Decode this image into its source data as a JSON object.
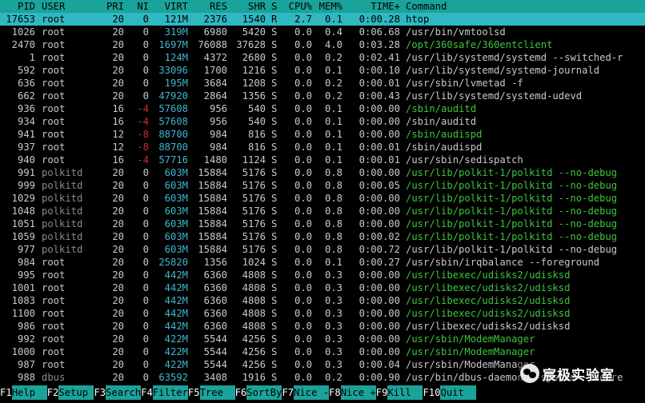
{
  "header": {
    "pid": "PID",
    "user": "USER",
    "pri": "PRI",
    "ni": "NI",
    "virt": "VIRT",
    "res": "RES",
    "shr": "SHR",
    "s": "S",
    "cpu": "CPU%",
    "mem": "MEM%",
    "time": "TIME+",
    "command": "Command"
  },
  "processes": [
    {
      "pid": "17653",
      "user": "root",
      "pri": "20",
      "ni": "0",
      "virt": "121M",
      "res": "2376",
      "shr": "1540",
      "s": "R",
      "cpu": "2.7",
      "mem": "0.1",
      "time": "0:00.28",
      "command": "htop",
      "selected": true
    },
    {
      "pid": "1026",
      "user": "root",
      "pri": "20",
      "ni": "0",
      "virt": "319M",
      "res": "6980",
      "shr": "5420",
      "s": "S",
      "cpu": "0.0",
      "mem": "0.4",
      "time": "0:06.68",
      "command": "/usr/bin/vmtoolsd"
    },
    {
      "pid": "2470",
      "user": "root",
      "pri": "20",
      "ni": "0",
      "virt": "1697M",
      "res": "76088",
      "shr": "37628",
      "s": "S",
      "cpu": "0.0",
      "mem": "4.0",
      "time": "0:03.28",
      "command": "/opt/360safe/360entclient",
      "thread": true
    },
    {
      "pid": "1",
      "user": "root",
      "pri": "20",
      "ni": "0",
      "virt": "124M",
      "res": "4372",
      "shr": "2680",
      "s": "S",
      "cpu": "0.0",
      "mem": "0.2",
      "time": "0:02.41",
      "command": "/usr/lib/systemd/systemd --switched-r"
    },
    {
      "pid": "592",
      "user": "root",
      "pri": "20",
      "ni": "0",
      "virt": "33096",
      "res": "1700",
      "shr": "1216",
      "s": "S",
      "cpu": "0.0",
      "mem": "0.1",
      "time": "0:00.10",
      "command": "/usr/lib/systemd/systemd-journald"
    },
    {
      "pid": "636",
      "user": "root",
      "pri": "20",
      "ni": "0",
      "virt": "195M",
      "res": "3684",
      "shr": "1208",
      "s": "S",
      "cpu": "0.0",
      "mem": "0.2",
      "time": "0:00.01",
      "command": "/usr/sbin/lvmetad -f"
    },
    {
      "pid": "662",
      "user": "root",
      "pri": "20",
      "ni": "0",
      "virt": "47920",
      "res": "2864",
      "shr": "1356",
      "s": "S",
      "cpu": "0.0",
      "mem": "0.2",
      "time": "0:00.43",
      "command": "/usr/lib/systemd/systemd-udevd"
    },
    {
      "pid": "936",
      "user": "root",
      "pri": "16",
      "ni": "-4",
      "virt": "57608",
      "res": "956",
      "shr": "540",
      "s": "S",
      "cpu": "0.0",
      "mem": "0.1",
      "time": "0:00.00",
      "command": "/sbin/auditd",
      "thread": true
    },
    {
      "pid": "934",
      "user": "root",
      "pri": "16",
      "ni": "-4",
      "virt": "57608",
      "res": "956",
      "shr": "540",
      "s": "S",
      "cpu": "0.0",
      "mem": "0.1",
      "time": "0:00.00",
      "command": "/sbin/auditd"
    },
    {
      "pid": "941",
      "user": "root",
      "pri": "12",
      "ni": "-8",
      "virt": "88700",
      "res": "984",
      "shr": "816",
      "s": "S",
      "cpu": "0.0",
      "mem": "0.1",
      "time": "0:00.00",
      "command": "/sbin/audispd",
      "thread": true
    },
    {
      "pid": "937",
      "user": "root",
      "pri": "12",
      "ni": "-8",
      "virt": "88700",
      "res": "984",
      "shr": "816",
      "s": "S",
      "cpu": "0.0",
      "mem": "0.1",
      "time": "0:00.01",
      "command": "/sbin/audispd"
    },
    {
      "pid": "940",
      "user": "root",
      "pri": "16",
      "ni": "-4",
      "virt": "57716",
      "res": "1480",
      "shr": "1124",
      "s": "S",
      "cpu": "0.0",
      "mem": "0.1",
      "time": "0:00.01",
      "command": "/usr/sbin/sedispatch"
    },
    {
      "pid": "991",
      "user": "polkitd",
      "pri": "20",
      "ni": "0",
      "virt": "603M",
      "res": "15884",
      "shr": "5176",
      "s": "S",
      "cpu": "0.0",
      "mem": "0.8",
      "time": "0:00.00",
      "command": "/usr/lib/polkit-1/polkitd --no-debug",
      "thread": true
    },
    {
      "pid": "999",
      "user": "polkitd",
      "pri": "20",
      "ni": "0",
      "virt": "603M",
      "res": "15884",
      "shr": "5176",
      "s": "S",
      "cpu": "0.0",
      "mem": "0.8",
      "time": "0:00.05",
      "command": "/usr/lib/polkit-1/polkitd --no-debug",
      "thread": true
    },
    {
      "pid": "1029",
      "user": "polkitd",
      "pri": "20",
      "ni": "0",
      "virt": "603M",
      "res": "15884",
      "shr": "5176",
      "s": "S",
      "cpu": "0.0",
      "mem": "0.8",
      "time": "0:00.00",
      "command": "/usr/lib/polkit-1/polkitd --no-debug",
      "thread": true
    },
    {
      "pid": "1048",
      "user": "polkitd",
      "pri": "20",
      "ni": "0",
      "virt": "603M",
      "res": "15884",
      "shr": "5176",
      "s": "S",
      "cpu": "0.0",
      "mem": "0.8",
      "time": "0:00.00",
      "command": "/usr/lib/polkit-1/polkitd --no-debug",
      "thread": true
    },
    {
      "pid": "1051",
      "user": "polkitd",
      "pri": "20",
      "ni": "0",
      "virt": "603M",
      "res": "15884",
      "shr": "5176",
      "s": "S",
      "cpu": "0.0",
      "mem": "0.8",
      "time": "0:00.00",
      "command": "/usr/lib/polkit-1/polkitd --no-debug",
      "thread": true
    },
    {
      "pid": "1059",
      "user": "polkitd",
      "pri": "20",
      "ni": "0",
      "virt": "603M",
      "res": "15884",
      "shr": "5176",
      "s": "S",
      "cpu": "0.0",
      "mem": "0.8",
      "time": "0:00.02",
      "command": "/usr/lib/polkit-1/polkitd --no-debug",
      "thread": true
    },
    {
      "pid": "977",
      "user": "polkitd",
      "pri": "20",
      "ni": "0",
      "virt": "603M",
      "res": "15884",
      "shr": "5176",
      "s": "S",
      "cpu": "0.0",
      "mem": "0.8",
      "time": "0:00.72",
      "command": "/usr/lib/polkit-1/polkitd --no-debug"
    },
    {
      "pid": "984",
      "user": "root",
      "pri": "20",
      "ni": "0",
      "virt": "25820",
      "res": "1356",
      "shr": "1024",
      "s": "S",
      "cpu": "0.0",
      "mem": "0.1",
      "time": "0:00.27",
      "command": "/usr/sbin/irqbalance --foreground"
    },
    {
      "pid": "995",
      "user": "root",
      "pri": "20",
      "ni": "0",
      "virt": "442M",
      "res": "6360",
      "shr": "4808",
      "s": "S",
      "cpu": "0.0",
      "mem": "0.3",
      "time": "0:00.00",
      "command": "/usr/libexec/udisks2/udisksd",
      "thread": true
    },
    {
      "pid": "1001",
      "user": "root",
      "pri": "20",
      "ni": "0",
      "virt": "442M",
      "res": "6360",
      "shr": "4808",
      "s": "S",
      "cpu": "0.0",
      "mem": "0.3",
      "time": "0:00.00",
      "command": "/usr/libexec/udisks2/udisksd",
      "thread": true
    },
    {
      "pid": "1083",
      "user": "root",
      "pri": "20",
      "ni": "0",
      "virt": "442M",
      "res": "6360",
      "shr": "4808",
      "s": "S",
      "cpu": "0.0",
      "mem": "0.3",
      "time": "0:00.00",
      "command": "/usr/libexec/udisks2/udisksd",
      "thread": true
    },
    {
      "pid": "1100",
      "user": "root",
      "pri": "20",
      "ni": "0",
      "virt": "442M",
      "res": "6360",
      "shr": "4808",
      "s": "S",
      "cpu": "0.0",
      "mem": "0.3",
      "time": "0:00.00",
      "command": "/usr/libexec/udisks2/udisksd",
      "thread": true
    },
    {
      "pid": "986",
      "user": "root",
      "pri": "20",
      "ni": "0",
      "virt": "442M",
      "res": "6360",
      "shr": "4808",
      "s": "S",
      "cpu": "0.0",
      "mem": "0.3",
      "time": "0:00.00",
      "command": "/usr/libexec/udisks2/udisksd"
    },
    {
      "pid": "992",
      "user": "root",
      "pri": "20",
      "ni": "0",
      "virt": "422M",
      "res": "5544",
      "shr": "4256",
      "s": "S",
      "cpu": "0.0",
      "mem": "0.3",
      "time": "0:00.00",
      "command": "/usr/sbin/ModemManager",
      "thread": true
    },
    {
      "pid": "1000",
      "user": "root",
      "pri": "20",
      "ni": "0",
      "virt": "422M",
      "res": "5544",
      "shr": "4256",
      "s": "S",
      "cpu": "0.0",
      "mem": "0.3",
      "time": "0:00.00",
      "command": "/usr/sbin/ModemManager",
      "thread": true
    },
    {
      "pid": "987",
      "user": "root",
      "pri": "20",
      "ni": "0",
      "virt": "422M",
      "res": "5544",
      "shr": "4256",
      "s": "S",
      "cpu": "0.0",
      "mem": "0.3",
      "time": "0:00.04",
      "command": "/usr/sbin/ModemManager"
    },
    {
      "pid": "988",
      "user": "dbus",
      "pri": "20",
      "ni": "0",
      "virt": "63592",
      "res": "3408",
      "shr": "1916",
      "s": "S",
      "cpu": "0.0",
      "mem": "0.2",
      "time": "0:00.90",
      "command": "/usr/bin/dbus-daemon --system --addre",
      "partial": true
    }
  ],
  "footer": [
    {
      "key": "F1",
      "label": "Help  "
    },
    {
      "key": "F2",
      "label": "Setup "
    },
    {
      "key": "F3",
      "label": "Search"
    },
    {
      "key": "F4",
      "label": "Filter"
    },
    {
      "key": "F5",
      "label": "Tree  "
    },
    {
      "key": "F6",
      "label": "SortBy"
    },
    {
      "key": "F7",
      "label": "Nice -"
    },
    {
      "key": "F8",
      "label": "Nice +"
    },
    {
      "key": "F9",
      "label": "Kill  "
    },
    {
      "key": "F10",
      "label": "Quit  "
    }
  ],
  "watermark": {
    "text": "宸极实验室",
    "logo": "wechat-logo"
  },
  "colors": {
    "header_bg": "#1aa39a",
    "selected_bg": "#2fb8c2",
    "thread_green": "#3ec43e",
    "size_cyan": "#3fb6cf",
    "nice_red": "#d62a2a"
  }
}
